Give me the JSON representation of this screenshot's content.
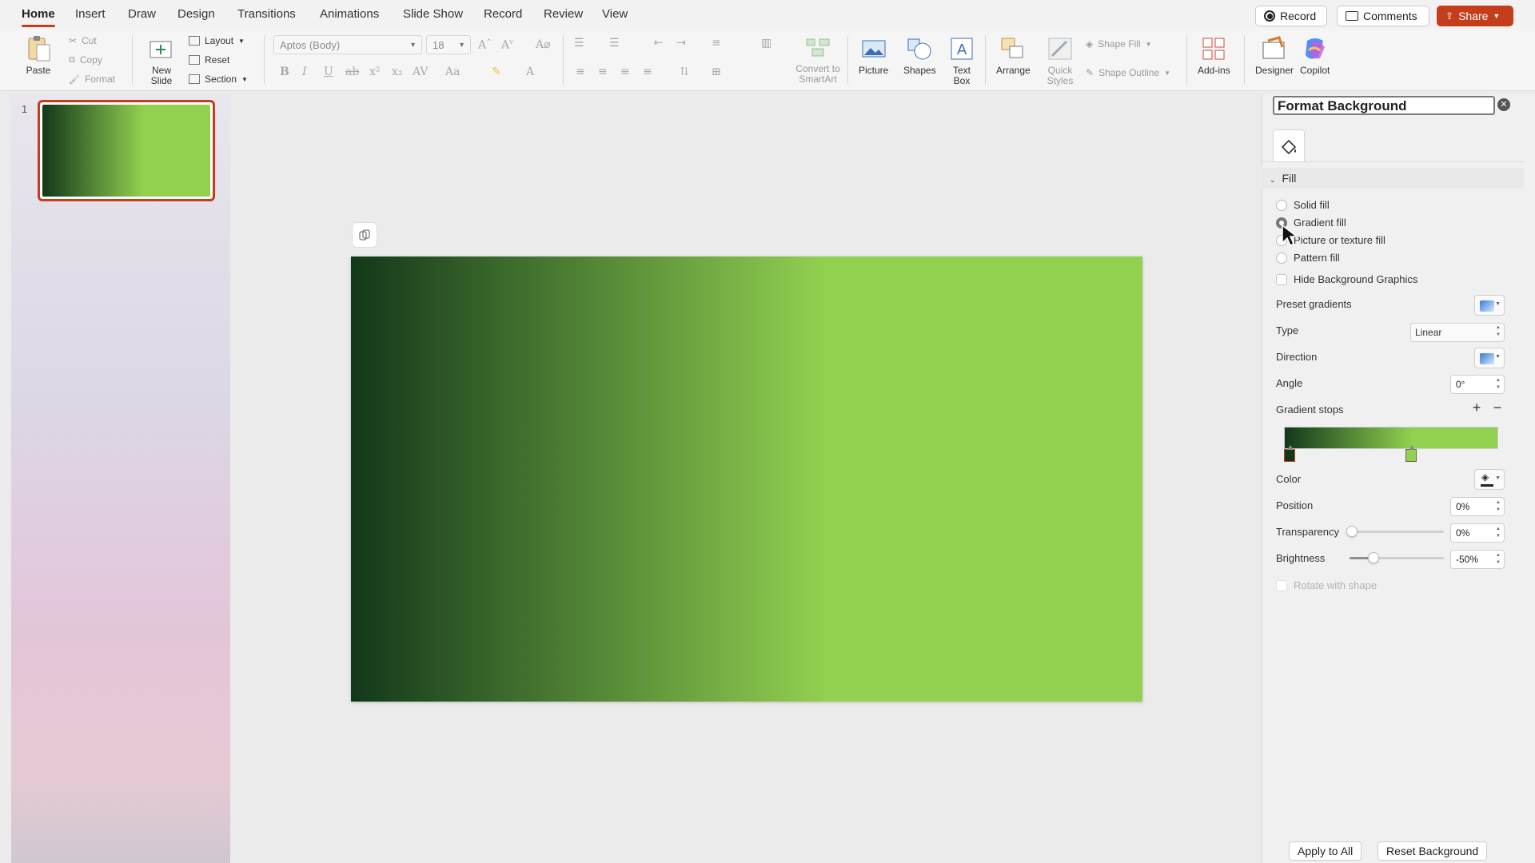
{
  "tabs": [
    {
      "label": "Home",
      "active": true
    },
    {
      "label": "Insert"
    },
    {
      "label": "Draw"
    },
    {
      "label": "Design"
    },
    {
      "label": "Transitions"
    },
    {
      "label": "Animations"
    },
    {
      "label": "Slide Show"
    },
    {
      "label": "Record"
    },
    {
      "label": "Review"
    },
    {
      "label": "View"
    }
  ],
  "top_actions": {
    "record": "Record",
    "comments": "Comments",
    "share": "Share"
  },
  "ribbon": {
    "paste": "Paste",
    "cut": "Cut",
    "copy": "Copy",
    "format": "Format",
    "new_slide": "New Slide",
    "layout": "Layout",
    "reset": "Reset",
    "section": "Section",
    "font_name": "Aptos (Body)",
    "font_size": "18",
    "convert_smartart": "Convert to SmartArt",
    "picture": "Picture",
    "shapes": "Shapes",
    "text_box": "Text Box",
    "arrange": "Arrange",
    "quick_styles": "Quick Styles",
    "shape_fill": "Shape Fill",
    "shape_outline": "Shape Outline",
    "add_ins": "Add-ins",
    "designer": "Designer",
    "copilot": "Copilot"
  },
  "thumbnails": [
    {
      "number": "1"
    }
  ],
  "slide": {
    "gradient": {
      "start_color": "#12381a",
      "end_color": "#92d050",
      "end_position": 0.6
    }
  },
  "format_pane": {
    "title": "Format Background",
    "section": "Fill",
    "fill_options": [
      "Solid fill",
      "Gradient fill",
      "Picture or texture fill",
      "Pattern fill"
    ],
    "selected_fill": "Gradient fill",
    "hide_background_graphics": "Hide Background Graphics",
    "preset_gradients_label": "Preset gradients",
    "type_label": "Type",
    "type_value": "Linear",
    "direction_label": "Direction",
    "angle_label": "Angle",
    "angle_value": "0°",
    "gradient_stops_label": "Gradient stops",
    "stops": [
      {
        "position": 0,
        "color": "#12381a",
        "selected": true
      },
      {
        "position": 0.6,
        "color": "#92d050",
        "selected": false
      }
    ],
    "color_label": "Color",
    "position_label": "Position",
    "position_value": "0%",
    "transparency_label": "Transparency",
    "transparency_value": "0%",
    "transparency_level": 0,
    "brightness_label": "Brightness",
    "brightness_value": "-50%",
    "brightness_level": -0.5,
    "rotate_with_shape": "Rotate with shape",
    "apply_to_all": "Apply to All",
    "reset_background": "Reset Background"
  },
  "colors": {
    "accent": "#c43e1c",
    "gradient_dark": "#12381a",
    "gradient_light": "#92d050"
  }
}
